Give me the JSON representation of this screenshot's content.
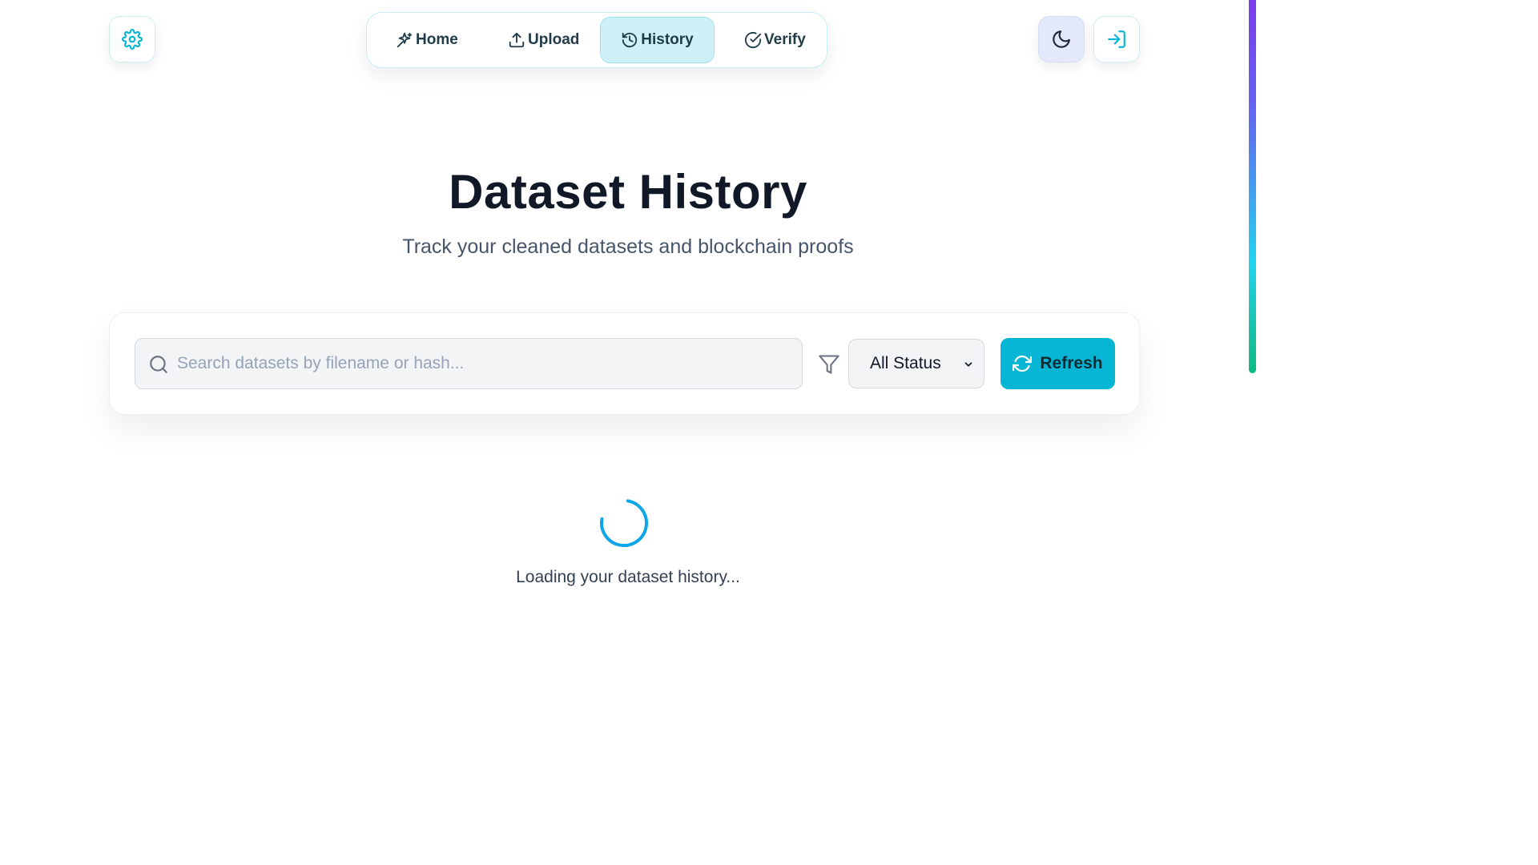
{
  "nav": {
    "items": [
      {
        "label": "Home",
        "icon": "sparkles-icon"
      },
      {
        "label": "Upload",
        "icon": "upload-icon"
      },
      {
        "label": "History",
        "icon": "history-icon",
        "active": true
      },
      {
        "label": "Verify",
        "icon": "check-circle-icon"
      }
    ]
  },
  "header": {
    "settings_icon": "gear-icon",
    "theme_icon": "moon-icon",
    "login_icon": "sign-in-icon"
  },
  "page": {
    "title": "Dataset History",
    "subtitle": "Track your cleaned datasets and blockchain proofs"
  },
  "toolbar": {
    "search_placeholder": "Search datasets by filename or hash...",
    "search_value": "",
    "status_selected": "All Status",
    "refresh_label": "Refresh"
  },
  "loading": {
    "text": "Loading your dataset history..."
  },
  "colors": {
    "accent": "#06b6d4",
    "active_nav_bg": "#cdf1f7",
    "title": "#111827"
  }
}
